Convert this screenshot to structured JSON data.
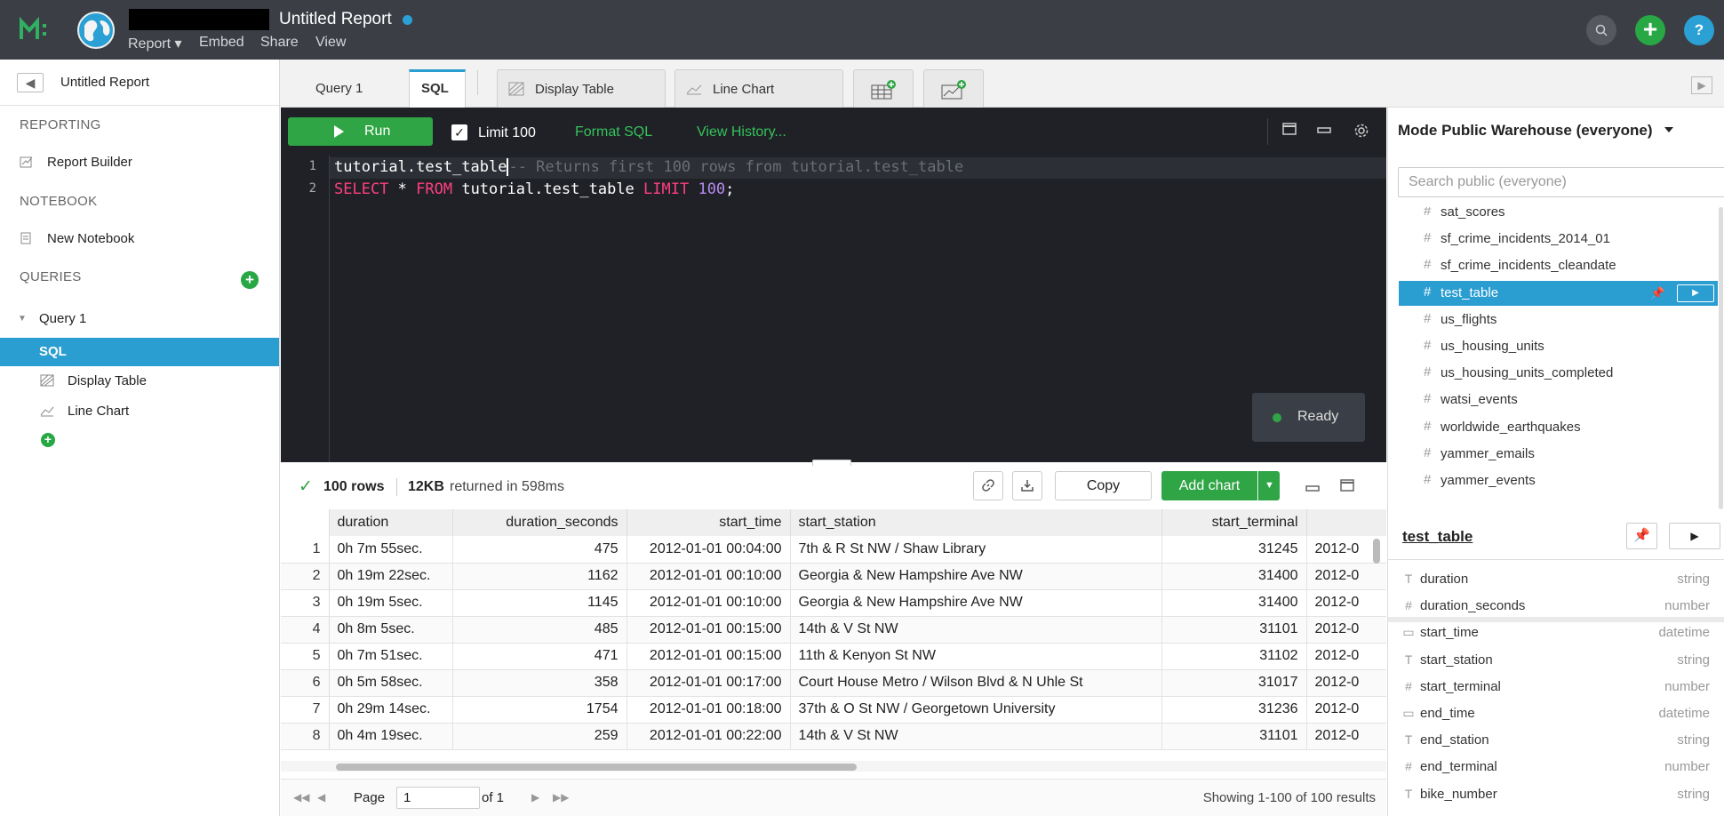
{
  "app": {
    "title": "Untitled Report",
    "menu": [
      "Report ▾",
      "Embed",
      "Share",
      "View"
    ],
    "search_icon": "search-icon",
    "help_label": "?",
    "add_label": "+"
  },
  "sidebar": {
    "report_title": "Untitled Report",
    "sections": {
      "reporting": "REPORTING",
      "notebook": "NOTEBOOK",
      "queries": "QUERIES"
    },
    "report_builder": "Report Builder",
    "new_notebook": "New Notebook",
    "query_name": "Query 1",
    "sql": "SQL",
    "display_table": "Display Table",
    "line_chart": "Line Chart"
  },
  "tabs": {
    "query": "Query 1",
    "sql": "SQL",
    "display_table": "Display Table",
    "line_chart": "Line Chart"
  },
  "editor": {
    "run_label": "Run",
    "limit_label": "Limit 100",
    "limit_checked": true,
    "format_sql": "Format SQL",
    "view_history": "View History...",
    "line1_code": "tutorial.test_table",
    "line1_comment": "-- Returns first 100 rows from tutorial.test_table",
    "line2": {
      "select": "SELECT",
      "star": " * ",
      "from": "FROM",
      "table": " tutorial.test_table ",
      "limit": "LIMIT",
      "num": " 100",
      "semi": ";"
    },
    "line_numbers": [
      "1",
      "2"
    ],
    "status": "Ready"
  },
  "results": {
    "rows_count": "100 rows",
    "size": "12KB",
    "returned": "returned in 598ms",
    "copy_label": "Copy",
    "add_chart_label": "Add chart",
    "columns": [
      "",
      "duration",
      "duration_seconds",
      "start_time",
      "start_station",
      "start_terminal",
      ""
    ],
    "rows": [
      [
        "1",
        "0h 7m 55sec.",
        "475",
        "2012-01-01 00:04:00",
        "7th & R St NW / Shaw Library",
        "31245",
        "2012-0"
      ],
      [
        "2",
        "0h 19m 22sec.",
        "1162",
        "2012-01-01 00:10:00",
        "Georgia & New Hampshire Ave NW",
        "31400",
        "2012-0"
      ],
      [
        "3",
        "0h 19m 5sec.",
        "1145",
        "2012-01-01 00:10:00",
        "Georgia & New Hampshire Ave NW",
        "31400",
        "2012-0"
      ],
      [
        "4",
        "0h 8m 5sec.",
        "485",
        "2012-01-01 00:15:00",
        "14th & V St NW",
        "31101",
        "2012-0"
      ],
      [
        "5",
        "0h 7m 51sec.",
        "471",
        "2012-01-01 00:15:00",
        "11th & Kenyon St NW",
        "31102",
        "2012-0"
      ],
      [
        "6",
        "0h 5m 58sec.",
        "358",
        "2012-01-01 00:17:00",
        "Court House Metro / Wilson Blvd & N Uhle St",
        "31017",
        "2012-0"
      ],
      [
        "7",
        "0h 29m 14sec.",
        "1754",
        "2012-01-01 00:18:00",
        "37th & O St NW / Georgetown University",
        "31236",
        "2012-0"
      ],
      [
        "8",
        "0h 4m 19sec.",
        "259",
        "2012-01-01 00:22:00",
        "14th & V St NW",
        "31101",
        "2012-0"
      ]
    ],
    "pager": {
      "page_label": "Page",
      "page_value": "1",
      "of": "of 1",
      "showing": "Showing 1-100 of 100 results"
    }
  },
  "warehouse": {
    "name": "Mode Public Warehouse (everyone)",
    "search_placeholder": "Search public (everyone)",
    "tables": [
      "sat_scores",
      "sf_crime_incidents_2014_01",
      "sf_crime_incidents_cleandate",
      "test_table",
      "us_flights",
      "us_housing_units",
      "us_housing_units_completed",
      "watsi_events",
      "worldwide_earthquakes",
      "yammer_emails",
      "yammer_events"
    ],
    "selected_table": "test_table",
    "detail_title": "test_table",
    "detail_columns": [
      {
        "name": "duration",
        "type": "string",
        "icon": "T"
      },
      {
        "name": "duration_seconds",
        "type": "number",
        "icon": "#"
      },
      {
        "name": "start_time",
        "type": "datetime",
        "icon": "▭"
      },
      {
        "name": "start_station",
        "type": "string",
        "icon": "T"
      },
      {
        "name": "start_terminal",
        "type": "number",
        "icon": "#"
      },
      {
        "name": "end_time",
        "type": "datetime",
        "icon": "▭"
      },
      {
        "name": "end_station",
        "type": "string",
        "icon": "T"
      },
      {
        "name": "end_terminal",
        "type": "number",
        "icon": "#"
      },
      {
        "name": "bike_number",
        "type": "string",
        "icon": "T"
      }
    ]
  },
  "colors": {
    "accent": "#2a9dd1",
    "green": "#2fa545",
    "topbar": "#3b3f45",
    "editor_bg": "#1f2126"
  }
}
